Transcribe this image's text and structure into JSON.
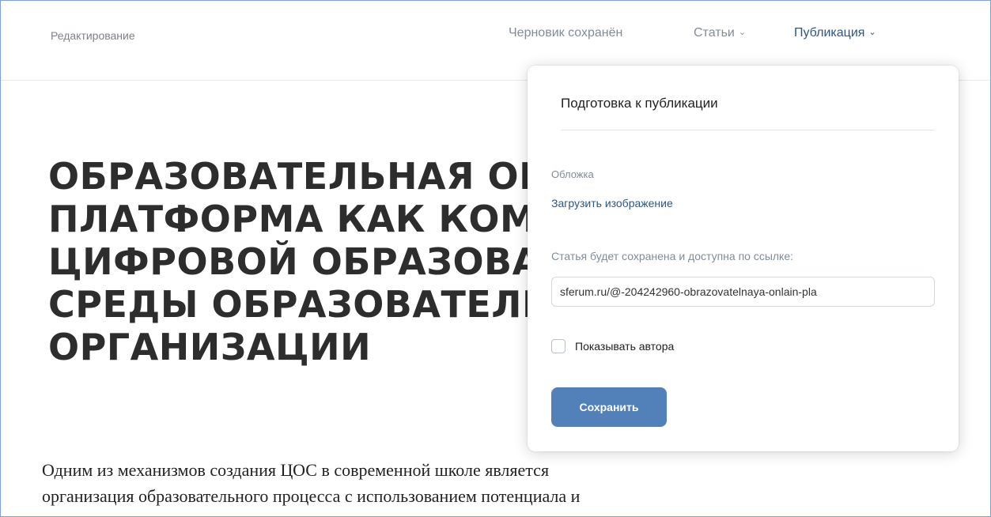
{
  "header": {
    "mode_label": "Редактирование",
    "draft_status": "Черновик сохранён",
    "articles_label": "Статьи",
    "publish_label": "Публикация"
  },
  "article": {
    "title_lines": [
      "ОБРАЗОВАТЕЛЬНАЯ ОНЛАЙН",
      "ПЛАТФОРМА КАК КОМПОНЕНТ",
      "ЦИФРОВОЙ ОБРАЗОВАТЕЛЬНОЙ",
      "СРЕДЫ ОБРАЗОВАТЕЛЬНОЙ",
      "ОРГАНИЗАЦИИ"
    ],
    "body_lines": [
      "Одним из механизмов создания ЦОС в современной школе является",
      "организация образовательного процесса с использованием потенциала и"
    ]
  },
  "publish_panel": {
    "title": "Подготовка к публикации",
    "cover_label": "Обложка",
    "upload_link": "Загрузить изображение",
    "url_label": "Статья будет сохранена и доступна по ссылке:",
    "url_value": "sferum.ru/@-204242960-obrazovatelnaya-onlain-pla",
    "show_author_label": "Показывать автора",
    "show_author_checked": false,
    "save_button": "Сохранить"
  },
  "colors": {
    "accent": "#5181b8",
    "link": "#2a5885",
    "muted": "#818c99"
  },
  "icons": {
    "articles_dropdown": "chevron-down-icon",
    "publish_dropdown": "chevron-down-icon"
  }
}
